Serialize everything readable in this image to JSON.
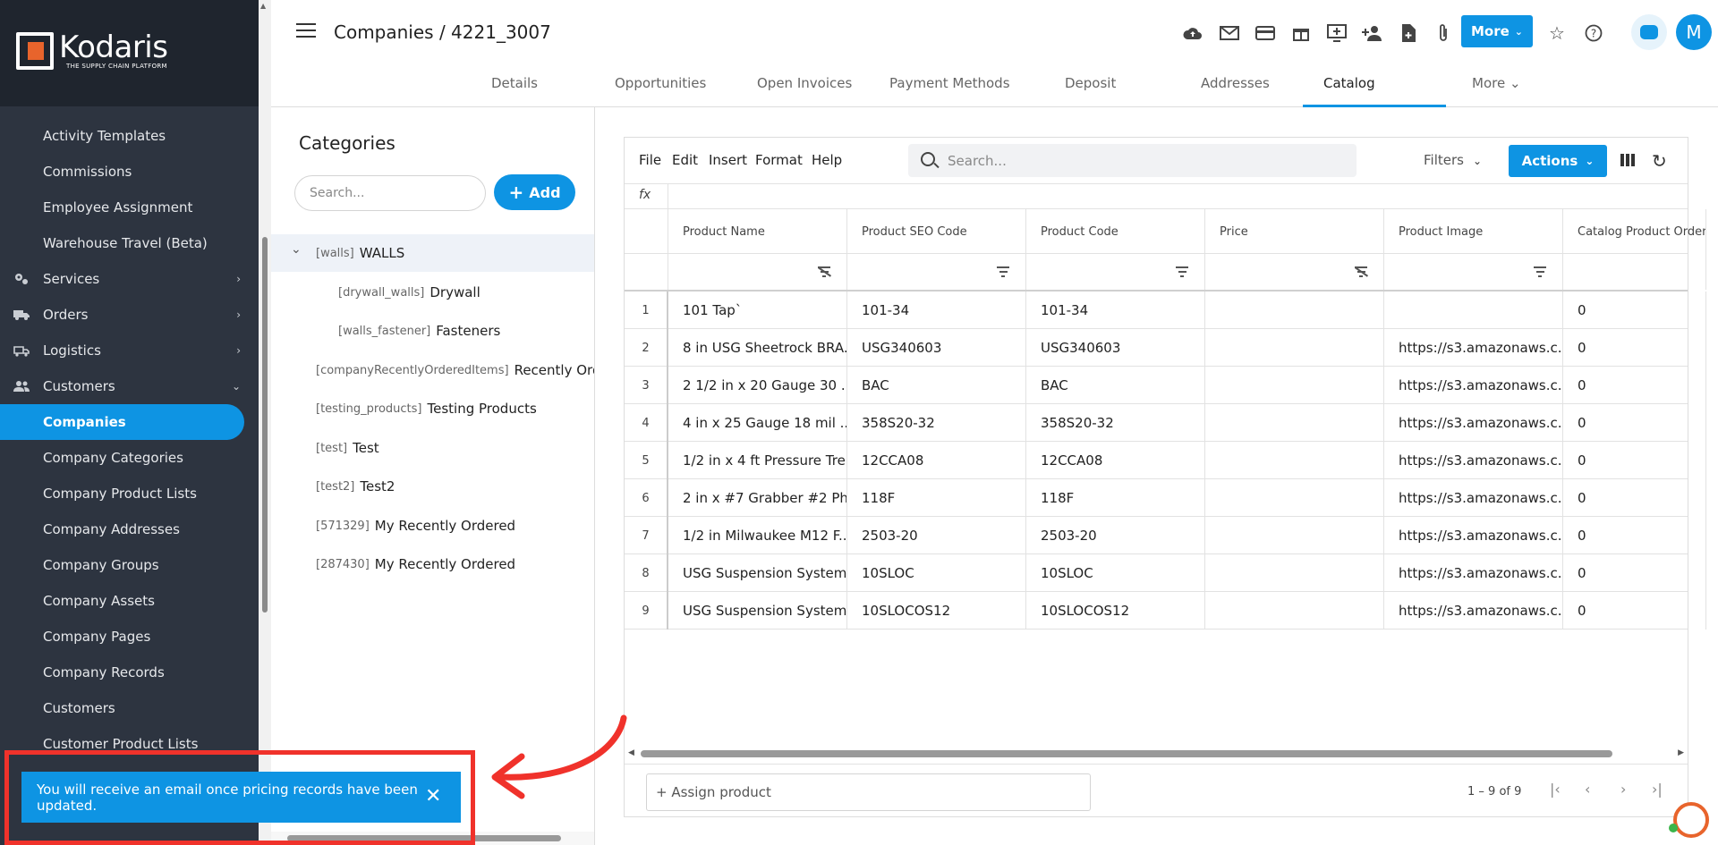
{
  "brand": {
    "name": "Kodaris",
    "tagline": "THE SUPPLY CHAIN PLATFORM",
    "accent": "#0e94e3",
    "highlight": "#f0322b"
  },
  "sidebar": {
    "items": [
      {
        "label": "Activity Templates",
        "icon": "",
        "chevron": ""
      },
      {
        "label": "Commissions",
        "icon": "",
        "chevron": ""
      },
      {
        "label": "Employee Assignment",
        "icon": "",
        "chevron": ""
      },
      {
        "label": "Warehouse Travel (Beta)",
        "icon": "",
        "chevron": ""
      },
      {
        "label": "Services",
        "icon": "gears-icon",
        "chevron": "›"
      },
      {
        "label": "Orders",
        "icon": "truck-icon",
        "chevron": "›"
      },
      {
        "label": "Logistics",
        "icon": "delivery-icon",
        "chevron": "›"
      },
      {
        "label": "Customers",
        "icon": "people-icon",
        "chevron": "⌄"
      },
      {
        "label": "Companies",
        "icon": "",
        "chevron": "",
        "active": true
      },
      {
        "label": "Company Categories",
        "icon": "",
        "chevron": ""
      },
      {
        "label": "Company Product Lists",
        "icon": "",
        "chevron": ""
      },
      {
        "label": "Company Addresses",
        "icon": "",
        "chevron": ""
      },
      {
        "label": "Company Groups",
        "icon": "",
        "chevron": ""
      },
      {
        "label": "Company Assets",
        "icon": "",
        "chevron": ""
      },
      {
        "label": "Company Pages",
        "icon": "",
        "chevron": ""
      },
      {
        "label": "Company Records",
        "icon": "",
        "chevron": ""
      },
      {
        "label": "Customers",
        "icon": "",
        "chevron": ""
      },
      {
        "label": "Customer Product Lists",
        "icon": "",
        "chevron": ""
      }
    ]
  },
  "toast": {
    "message": "You will receive an email once pricing records have been updated.",
    "close": "✕"
  },
  "header": {
    "title": "Companies / 4221_3007",
    "more_label": "More",
    "avatar": "M",
    "tabs": [
      {
        "label": "Details"
      },
      {
        "label": "Opportunities"
      },
      {
        "label": "Open Invoices"
      },
      {
        "label": "Payment Methods"
      },
      {
        "label": "Deposit"
      },
      {
        "label": "Addresses"
      },
      {
        "label": "Catalog",
        "active": true
      },
      {
        "label": "More"
      }
    ]
  },
  "categories": {
    "title": "Categories",
    "search_placeholder": "Search...",
    "add_label": "Add",
    "items": [
      {
        "code": "[walls]",
        "name": "WALLS"
      },
      {
        "code": "[drywall_walls]",
        "name": "Drywall"
      },
      {
        "code": "[walls_fastener]",
        "name": "Fasteners"
      },
      {
        "code": "[companyRecentlyOrderedItems]",
        "name": "Recently Ordered"
      },
      {
        "code": "[testing_products]",
        "name": "Testing Products"
      },
      {
        "code": "[test]",
        "name": "Test"
      },
      {
        "code": "[test2]",
        "name": "Test2"
      },
      {
        "code": "[571329]",
        "name": "My Recently Ordered"
      },
      {
        "code": "[287430]",
        "name": "My Recently Ordered"
      }
    ]
  },
  "grid": {
    "menu": [
      "File",
      "Edit",
      "Insert",
      "Format",
      "Help"
    ],
    "search_placeholder": "Search...",
    "filters_label": "Filters",
    "actions_label": "Actions",
    "fx": "fx",
    "columns": [
      "Product Name",
      "Product SEO Code",
      "Product Code",
      "Price",
      "Product Image",
      "Catalog Product Order"
    ],
    "rows": [
      {
        "n": "1",
        "name": "101 Tap`",
        "seo": "101-34",
        "code": "101-34",
        "price": "",
        "image": "",
        "order": "0"
      },
      {
        "n": "2",
        "name": "8 in USG Sheetrock BRA...",
        "seo": "USG340603",
        "code": "USG340603",
        "price": "",
        "image": "https://s3.amazonaws.c...",
        "order": "0"
      },
      {
        "n": "3",
        "name": "2 1/2 in x 20 Gauge 30 ...",
        "seo": "BAC",
        "code": "BAC",
        "price": "",
        "image": "https://s3.amazonaws.c...",
        "order": "0"
      },
      {
        "n": "4",
        "name": "4 in x 25 Gauge 18 mil ...",
        "seo": "358S20-32",
        "code": "358S20-32",
        "price": "",
        "image": "https://s3.amazonaws.c...",
        "order": "0"
      },
      {
        "n": "5",
        "name": "1/2 in x 4 ft Pressure Tre...",
        "seo": "12CCA08",
        "code": "12CCA08",
        "price": "",
        "image": "https://s3.amazonaws.c...",
        "order": "0"
      },
      {
        "n": "6",
        "name": "2 in x #7 Grabber #2 Phi...",
        "seo": "118F",
        "code": "118F",
        "price": "",
        "image": "https://s3.amazonaws.c...",
        "order": "0"
      },
      {
        "n": "7",
        "name": "1/2 in Milwaukee M12 F...",
        "seo": "2503-20",
        "code": "2503-20",
        "price": "",
        "image": "https://s3.amazonaws.c...",
        "order": "0"
      },
      {
        "n": "8",
        "name": "USG Suspension System...",
        "seo": "10SLOC",
        "code": "10SLOC",
        "price": "",
        "image": "https://s3.amazonaws.c...",
        "order": "0"
      },
      {
        "n": "9",
        "name": "USG Suspension System...",
        "seo": "10SLOCOS12",
        "code": "10SLOCOS12",
        "price": "",
        "image": "https://s3.amazonaws.c...",
        "order": "0"
      }
    ],
    "assign_placeholder": "+ Assign product",
    "page_count": "1 – 9 of 9"
  }
}
